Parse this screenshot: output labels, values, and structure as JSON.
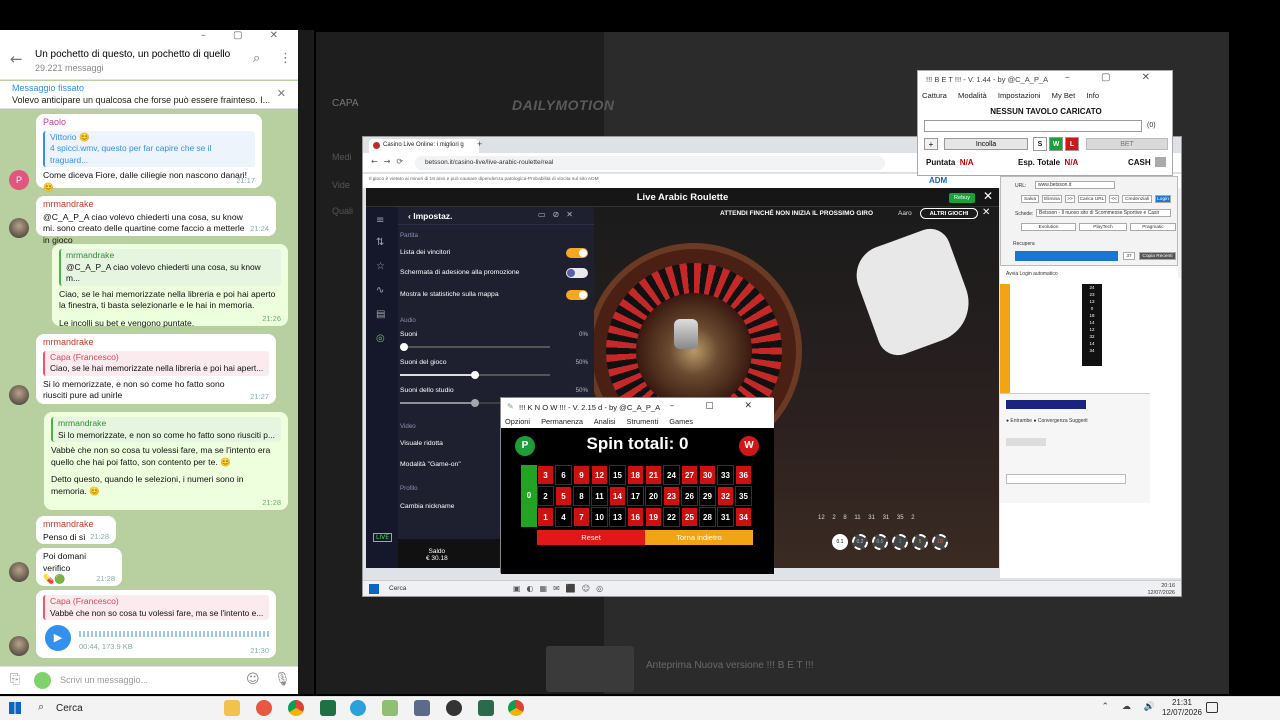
{
  "telegram": {
    "chat_title": "Un pochetto di questo, un pochetto di quello",
    "subtitle": "29.221 messaggi",
    "pinned": {
      "label": "Messaggio fissato",
      "text": "Volevo anticipare un qualcosa che forse può essere frainteso. I..."
    },
    "messages": [
      {
        "sender": "Paolo",
        "quote_name": "Vittorio 😊",
        "quote_text": "4 spicci.wmv, questo per far capire che se il traguard...",
        "text": "Come diceva Fiore, dalle ciliegie non nascono danari! 😊",
        "time": "21:17"
      },
      {
        "sender": "mrmandrake",
        "text": "@C_A_P_A ciao volevo chiederti una cosa, su know mi. sono creato delle quartine come faccio a metterle in gioco",
        "time": "21:24"
      },
      {
        "sender": "mrmandrake",
        "quote_text": "@C_A_P_A ciao volevo chiederti una cosa, su know m...",
        "text": "Ciao, se le hai memorizzate nella libreria e poi hai aperto la finestra, ti basta selezionarle e le hai in memoria.",
        "text2": "Le incolli su bet e vengono puntate.",
        "time": "21:26"
      },
      {
        "sender": "mrmandrake",
        "quote_name": "Capa (Francesco)",
        "quote_text": "Ciao, se le hai memorizzate nella libreria e poi hai apert...",
        "text": "Si lo memorizzate, e non so come ho fatto sono riusciti pure ad unirle",
        "time": "21:27"
      },
      {
        "sender": "mrmandrake",
        "quote_text": "Si lo memorizzate, e non so come ho fatto sono riusciti p...",
        "text": "Vabbè che non so cosa tu volessi fare, ma se l'intento era quello che hai poi fatto, son contento per te. 😊",
        "text2": "Detto questo, quando le selezioni, i numeri sono in memoria. 😊",
        "time": "21:28"
      },
      {
        "sender": "mrmandrake",
        "text": "Penso di sì",
        "time": "21:28"
      },
      {
        "text": "Poi domani verifico",
        "time": "21:28"
      },
      {
        "quote_name": "Capa (Francesco)",
        "quote_text": "Vabbè che non so cosa tu volessi fare, ma se l'intento e...",
        "voice_meta": "00:44, 173.9 KB",
        "time": "21:30"
      }
    ],
    "input_placeholder": "Scrivi un messaggio..."
  },
  "background": {
    "brand": "DAILYMOTION",
    "left_items": [
      "CAPA",
      "Medi",
      "Vide",
      "Quali"
    ],
    "video_title": "Anteprima Nuova versione !!! B E T !!!"
  },
  "chrome": {
    "tab": "Casino Live Online: i migliori g",
    "url": "betsson.it/casino-live/live-arabic-roulette/real",
    "notice": "Il gioco è vietato ai minori di 18 anni e può causare dipendenza patologica-Probabilità di vincita sul sito ADM",
    "adm": "ADM"
  },
  "game": {
    "title": "Live Arabic Roulette",
    "rebuy": "Rebuy",
    "banner": "ATTENDI FINCHÉ NON INIZIA IL PROSSIMO GIRO",
    "top_right": "Aaro",
    "altri": "ALTRI GIOCHI",
    "settings": {
      "title": "Impostaz.",
      "sections": [
        "Partita",
        "Audio",
        "Video",
        "Profilo"
      ],
      "toggles": [
        {
          "label": "Lista dei vincitori",
          "on": true
        },
        {
          "label": "Schermata di adesione alla promozione",
          "on": false
        },
        {
          "label": "Mostra le statistiche sulla mappa",
          "on": true
        }
      ],
      "sliders": [
        {
          "label": "Suoni",
          "value": "0%",
          "level": 0
        },
        {
          "label": "Suoni del gioco",
          "value": "50%",
          "level": 0.5
        },
        {
          "label": "Suoni dello studio",
          "value": "50%",
          "level": 0.5
        }
      ],
      "video": [
        "Visuale ridotta",
        "Modalità \"Game-on\""
      ],
      "profile": "Cambia nickname"
    },
    "saldo_label": "Saldo",
    "saldo_value": "€ 30.18",
    "history": "12 2 8 11 31 31 35 2",
    "chips": [
      "0.1",
      "0.2",
      "0.5",
      "1",
      "5",
      "10"
    ]
  },
  "know": {
    "title": "!!! K N O W !!! - V. 2.15 d - by @C_A_P_A",
    "menu": [
      "Opzioni",
      "Permanenza",
      "Analisi",
      "Strumenti",
      "Games"
    ],
    "spin_label": "Spin totali: 0",
    "p": "P",
    "w": "W",
    "zero": "0",
    "rows": [
      [
        "3",
        "6",
        "9",
        "12",
        "15",
        "18",
        "21",
        "24",
        "27",
        "30",
        "33",
        "36"
      ],
      [
        "2",
        "5",
        "8",
        "11",
        "14",
        "17",
        "20",
        "23",
        "26",
        "29",
        "32",
        "35"
      ],
      [
        "1",
        "4",
        "7",
        "10",
        "13",
        "16",
        "19",
        "22",
        "25",
        "28",
        "31",
        "34"
      ]
    ],
    "reds": [
      "1",
      "3",
      "5",
      "7",
      "9",
      "12",
      "14",
      "16",
      "18",
      "19",
      "21",
      "23",
      "25",
      "27",
      "30",
      "32",
      "34",
      "36"
    ],
    "reset": "Reset",
    "back": "Torna indietro"
  },
  "bet": {
    "title": "!!! B E T !!! - V. 1.44 - by @C_A_P_A",
    "menu": [
      "Cattura",
      "Modalità",
      "Impostazioni",
      "My Bet",
      "Info"
    ],
    "status": "NESSUN TAVOLO CARICATO",
    "count": "(0)",
    "plus": "+",
    "incolla": "Incolla",
    "s": "S",
    "w": "W",
    "l": "L",
    "bet_btn": "BET",
    "puntata_label": "Puntata",
    "puntata_val": "N/A",
    "esp_label": "Esp. Totale",
    "esp_val": "N/A",
    "cash_label": "CASH"
  },
  "helper": {
    "url_label": "URL:",
    "url": "www.betsson.it",
    "buttons": [
      "Salva",
      "Elimina",
      ">>",
      "Carica URL",
      "<<",
      "Credenziali",
      "Login"
    ],
    "schede_label": "Schede:",
    "schede": "Betsson - Il nuovo sito di Scommesse Sportive e Casir",
    "providers": [
      "Evolution",
      "PlayTech",
      "Pragmatic"
    ],
    "recupera": "Recupera",
    "recupera_n": "37",
    "copia": "Copia Recenti",
    "auto": "Avvia Login automatico"
  },
  "inner_taskbar": {
    "search": "Cerca",
    "time": "20:16",
    "date": "12/07/2026"
  },
  "taskbar": {
    "search": "Cerca",
    "time": "21:31",
    "date": "12/07/2026"
  }
}
